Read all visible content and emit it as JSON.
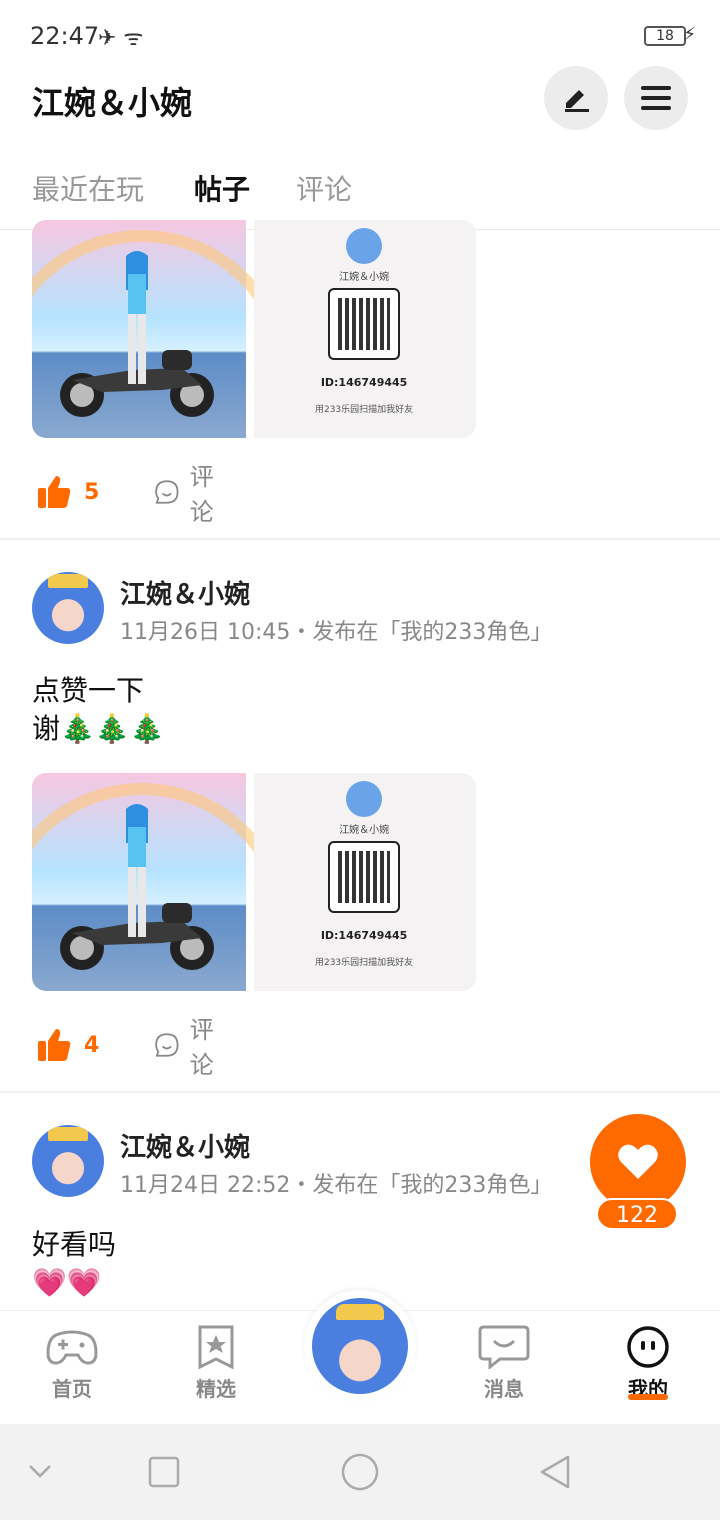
{
  "status_bar": {
    "time": "22:47",
    "icons": "✈ ᯤ",
    "battery": "18"
  },
  "header": {
    "title": "江婉＆小婉",
    "edit_icon": "pen-icon",
    "menu_icon": "menu-icon"
  },
  "tabs": [
    {
      "label": "最近在玩"
    },
    {
      "label": "帖子"
    },
    {
      "label": "评论"
    }
  ],
  "share_card": {
    "name": "江婉＆小婉",
    "id_text": "ID:146749445",
    "hint": "用233乐园扫描加我好友"
  },
  "posts": [
    {
      "likes": "5",
      "comment_label": "评论"
    },
    {
      "author": "江婉＆小婉",
      "meta": "11月26日 10:45・发布在「我的233角色」",
      "text_line1": "点赞一下",
      "text_line2": "谢🎄🎄🎄",
      "likes": "4",
      "comment_label": "评论"
    },
    {
      "author": "江婉＆小婉",
      "meta": "11月24日 22:52・发布在「我的233角色」",
      "text_line1": "好看吗",
      "text_line2": "💗💗"
    }
  ],
  "fab": {
    "count": "122"
  },
  "bottom_nav": [
    {
      "label": "首页"
    },
    {
      "label": "精选"
    },
    {
      "label": "消息"
    },
    {
      "label": "我的"
    }
  ],
  "colors": {
    "accent": "#ff6a00"
  }
}
